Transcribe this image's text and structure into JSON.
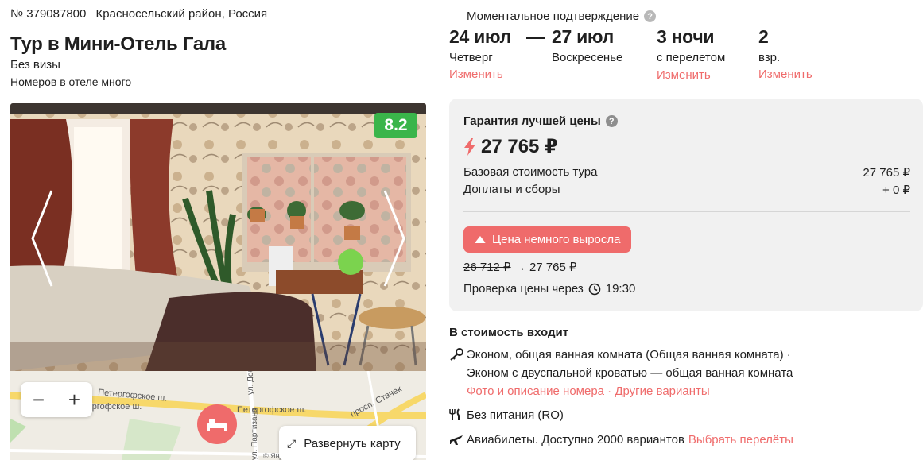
{
  "header": {
    "tour_number": "№ 379087800",
    "location": "Красносельский район, Россия",
    "title": "Тур в Мини-Отель Гала",
    "visa": "Без визы",
    "rooms_note": "Номеров в отеле много"
  },
  "gallery": {
    "rating": "8.2"
  },
  "map": {
    "zoom_out": "−",
    "zoom_in": "+",
    "expand_label": "Развернуть карту",
    "street_labels": [
      "Петергофское ш.",
      "Петергофское ш.",
      "просп. Стачек",
      "ул. Доблести",
      "ул. Партизана",
      "© Янд"
    ],
    "icon_names": [
      "bed-icon",
      "expand-arrows-icon"
    ]
  },
  "booking": {
    "confirm_label": "Моментальное подтверждение",
    "date_from": "24 июл",
    "dash": "—",
    "date_to": "27 июл",
    "day_from": "Четверг",
    "day_to": "Воскресенье",
    "nights": "3 ночи",
    "nights_note": "с перелетом",
    "guests": "2",
    "guests_note": "взр.",
    "change_label": "Изменить"
  },
  "price_box": {
    "guarantee": "Гарантия лучшей цены",
    "price": "27 765 ₽",
    "base_label": "Базовая стоимость тура",
    "base_value": "27 765 ₽",
    "extra_label": "Доплаты и сборы",
    "extra_value": "+ 0 ₽",
    "badge": "Цена немного выросла",
    "old_price": "26 712 ₽",
    "arrow": "→",
    "new_price": "27 765 ₽",
    "check_label": "Проверка цены через",
    "check_time": "19:30",
    "accent_color": "#ef6b6b"
  },
  "included": {
    "title": "В стоимость входит",
    "room_line1": "Эконом, общая ванная комната (Общая ванная комната) ·",
    "room_line2": "Эконом с двуспальной кроватью — общая ванная комната",
    "photo_link": "Фото и описание номера",
    "separator": "·",
    "other_link": "Другие варианты",
    "meals": "Без питания (RO)",
    "flights": "Авиабилеты. Доступно 2000 вариантов",
    "flights_link": "Выбрать перелёты",
    "icon_names": [
      "key-icon",
      "fork-knife-icon",
      "airplane-icon"
    ]
  }
}
